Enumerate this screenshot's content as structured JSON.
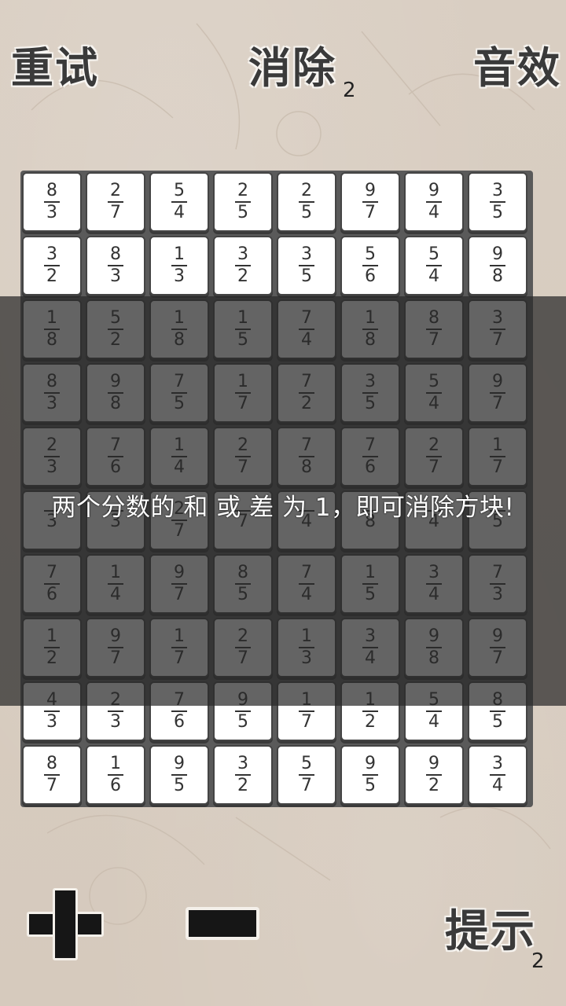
{
  "header": {
    "retry_label": "重试",
    "eliminate_label": "消除",
    "eliminate_count": "2",
    "sound_label": "音效"
  },
  "board": {
    "rows": [
      [
        [
          "8",
          "3"
        ],
        [
          "2",
          "7"
        ],
        [
          "5",
          "4"
        ],
        [
          "2",
          "5"
        ],
        [
          "2",
          "5"
        ],
        [
          "9",
          "7"
        ],
        [
          "9",
          "4"
        ],
        [
          "3",
          "5"
        ]
      ],
      [
        [
          "3",
          "2"
        ],
        [
          "8",
          "3"
        ],
        [
          "1",
          "3"
        ],
        [
          "3",
          "2"
        ],
        [
          "3",
          "5"
        ],
        [
          "5",
          "6"
        ],
        [
          "5",
          "4"
        ],
        [
          "9",
          "8"
        ]
      ],
      [
        [
          "1",
          "8"
        ],
        [
          "5",
          "2"
        ],
        [
          "1",
          "8"
        ],
        [
          "1",
          "5"
        ],
        [
          "7",
          "4"
        ],
        [
          "1",
          "8"
        ],
        [
          "8",
          "7"
        ],
        [
          "3",
          "7"
        ]
      ],
      [
        [
          "8",
          "3"
        ],
        [
          "9",
          "8"
        ],
        [
          "7",
          "5"
        ],
        [
          "1",
          "7"
        ],
        [
          "7",
          "2"
        ],
        [
          "3",
          "5"
        ],
        [
          "5",
          "4"
        ],
        [
          "9",
          "7"
        ]
      ],
      [
        [
          "2",
          "3"
        ],
        [
          "7",
          "6"
        ],
        [
          "1",
          "4"
        ],
        [
          "2",
          "7"
        ],
        [
          "7",
          "8"
        ],
        [
          "7",
          "6"
        ],
        [
          "2",
          "7"
        ],
        [
          "1",
          "7"
        ]
      ],
      [
        [
          "",
          "3"
        ],
        [
          "",
          "3"
        ],
        [
          "2",
          "7"
        ],
        [
          "",
          "7"
        ],
        [
          "",
          "4"
        ],
        [
          "",
          "8"
        ],
        [
          "",
          "4"
        ],
        [
          "",
          "5"
        ]
      ],
      [
        [
          "7",
          "6"
        ],
        [
          "1",
          "4"
        ],
        [
          "9",
          "7"
        ],
        [
          "8",
          "5"
        ],
        [
          "7",
          "4"
        ],
        [
          "1",
          "5"
        ],
        [
          "3",
          "4"
        ],
        [
          "7",
          "3"
        ]
      ],
      [
        [
          "1",
          "2"
        ],
        [
          "9",
          "7"
        ],
        [
          "1",
          "7"
        ],
        [
          "2",
          "7"
        ],
        [
          "1",
          "3"
        ],
        [
          "3",
          "4"
        ],
        [
          "9",
          "8"
        ],
        [
          "9",
          "7"
        ]
      ],
      [
        [
          "4",
          "3"
        ],
        [
          "2",
          "3"
        ],
        [
          "7",
          "6"
        ],
        [
          "9",
          "5"
        ],
        [
          "1",
          "7"
        ],
        [
          "1",
          "2"
        ],
        [
          "5",
          "4"
        ],
        [
          "8",
          "5"
        ]
      ],
      [
        [
          "8",
          "7"
        ],
        [
          "1",
          "6"
        ],
        [
          "9",
          "5"
        ],
        [
          "3",
          "2"
        ],
        [
          "5",
          "7"
        ],
        [
          "9",
          "5"
        ],
        [
          "9",
          "2"
        ],
        [
          "3",
          "4"
        ]
      ]
    ]
  },
  "overlay": {
    "message": "两个分数的 和 或 差 为 1，即可消除方块!"
  },
  "footer": {
    "plus_icon": "plus-icon",
    "minus_icon": "minus-icon",
    "hint_label": "提示",
    "hint_count": "2"
  }
}
